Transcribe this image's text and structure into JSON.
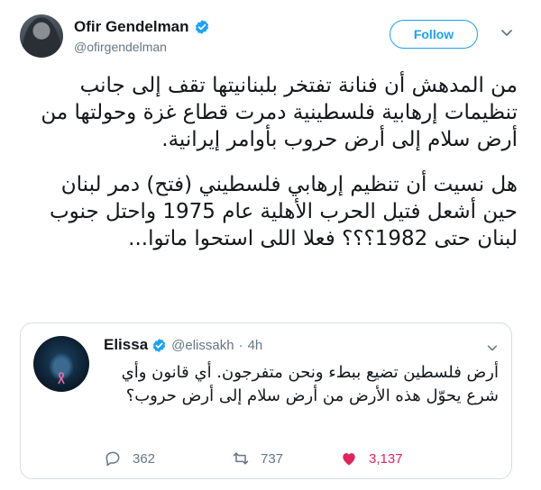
{
  "author": {
    "name": "Ofir Gendelman",
    "handle": "@ofirgendelman",
    "verified": true
  },
  "follow_label": "Follow",
  "tweet": {
    "paragraph1": "من المدهش أن فنانة تفتخر بلبنانيتها تقف إلى جانب تنظيمات إرهابية فلسطينية دمرت قطاع غزة وحولتها من أرض سلام إلى أرض حروب بأوامر إيرانية.",
    "paragraph2": "هل نسيت أن تنظيم إرهابي فلسطيني (فتح) دمر لبنان حين أشعل فتيل الحرب الأهلية عام 1975 واحتل جنوب لبنان حتى 1982؟؟؟ فعلا اللى استحوا ماتوا..."
  },
  "quoted": {
    "name": "Elissa",
    "handle": "@elissakh",
    "separator": "·",
    "time": "4h",
    "text": "أرض فلسطين تضيع ببطء ونحن متفرجون. أي قانون وأي شرع يحوّل هذه الأرض من أرض سلام إلى أرض حروب؟",
    "stats": {
      "replies": "362",
      "retweets": "737",
      "likes": "3,137"
    }
  },
  "colors": {
    "accent": "#1da1f2",
    "like": "#e0245e",
    "muted": "#657786",
    "text": "#14171a"
  },
  "icons": {
    "verified": "verified-badge-icon",
    "chevron": "chevron-down-icon",
    "reply": "reply-icon",
    "retweet": "retweet-icon",
    "like": "heart-icon"
  }
}
